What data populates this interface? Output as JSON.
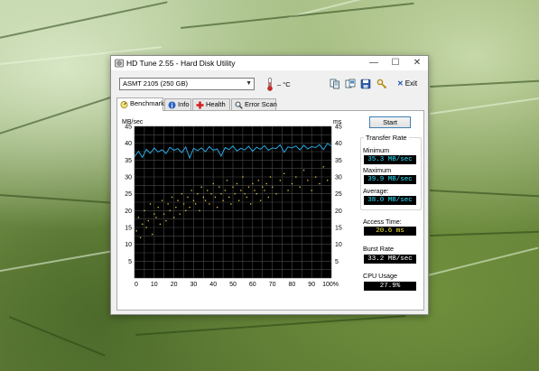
{
  "window": {
    "title": "HD Tune 2.55 - Hard Disk Utility",
    "controls": {
      "minimize": "—",
      "maximize": "☐",
      "close": "✕"
    }
  },
  "toolbar": {
    "drive": "ASMT    2105 (250 GB)",
    "temperature": "– °C",
    "exit_label": "Exit",
    "icons": [
      "copy-info-icon",
      "copy-screen-icon",
      "save-icon",
      "options-icon"
    ]
  },
  "tabs": [
    {
      "label": "Benchmark",
      "icon": "benchmark-icon",
      "active": true
    },
    {
      "label": "Info",
      "icon": "info-icon"
    },
    {
      "label": "Health",
      "icon": "health-icon"
    },
    {
      "label": "Error Scan",
      "icon": "search-icon"
    }
  ],
  "start_label": "Start",
  "stats": {
    "transfer_rate_title": "Transfer Rate",
    "minimum_label": "Minimum",
    "minimum": "35.3 MB/sec",
    "maximum_label": "Maximum",
    "maximum": "39.9 MB/sec",
    "average_label": "Average:",
    "average": "38.0 MB/sec",
    "access_time_label": "Access Time:",
    "access_time": "20.6 ms",
    "burst_rate_label": "Burst Rate",
    "burst_rate": "33.2 MB/sec",
    "cpu_usage_label": "CPU Usage",
    "cpu_usage": "27.9%"
  },
  "colors": {
    "transfer_line": "#2aa7e0",
    "access_dots": "#e8d24a",
    "stat_value": "#2ee6ff",
    "access_value": "#ffee33",
    "exit_x": "#1f53b4"
  },
  "chart_data": {
    "type": "line",
    "left_axis_unit": "MB/sec",
    "right_axis_unit": "ms",
    "x_tick_labels": [
      "0",
      "10",
      "20",
      "30",
      "40",
      "50",
      "60",
      "70",
      "80",
      "90",
      "100%"
    ],
    "y_left_ticks": [
      "45",
      "40",
      "35",
      "30",
      "25",
      "20",
      "15",
      "10",
      "5"
    ],
    "y_right_ticks": [
      "45",
      "40",
      "35",
      "30",
      "25",
      "20",
      "15",
      "10",
      "5"
    ],
    "xlim": [
      0,
      100
    ],
    "ylim": [
      0,
      45
    ],
    "grid": true,
    "series": [
      {
        "kind": "line",
        "unit": "MB/sec",
        "x": [
          0,
          2,
          4,
          6,
          8,
          10,
          12,
          14,
          16,
          18,
          20,
          22,
          24,
          26,
          28,
          30,
          32,
          34,
          36,
          38,
          40,
          42,
          44,
          46,
          48,
          50,
          52,
          54,
          56,
          58,
          60,
          62,
          64,
          66,
          68,
          70,
          72,
          74,
          76,
          78,
          80,
          82,
          84,
          86,
          88,
          90,
          92,
          94,
          96,
          98,
          100
        ],
        "y": [
          36.0,
          37.6,
          35.8,
          38.2,
          37.0,
          38.6,
          37.4,
          38.1,
          36.9,
          38.8,
          37.9,
          38.4,
          37.2,
          38.9,
          35.6,
          38.5,
          37.8,
          38.6,
          37.5,
          39.0,
          37.9,
          38.3,
          36.2,
          38.7,
          38.1,
          39.2,
          37.7,
          38.5,
          38.0,
          39.1,
          37.6,
          38.8,
          38.2,
          39.3,
          37.9,
          38.6,
          38.4,
          39.5,
          37.3,
          38.9,
          38.6,
          39.2,
          38.0,
          39.4,
          38.3,
          39.0,
          38.7,
          39.6,
          38.1,
          39.9,
          39.2
        ]
      },
      {
        "kind": "scatter",
        "unit": "ms",
        "x": [
          1,
          2,
          3,
          4,
          5,
          6,
          7,
          8,
          9,
          10,
          11,
          12,
          13,
          14,
          15,
          16,
          17,
          18,
          19,
          20,
          21,
          22,
          23,
          24,
          25,
          26,
          27,
          28,
          29,
          30,
          31,
          32,
          33,
          34,
          35,
          36,
          37,
          38,
          39,
          40,
          41,
          42,
          43,
          44,
          45,
          46,
          47,
          48,
          49,
          50,
          51,
          52,
          53,
          54,
          55,
          56,
          57,
          58,
          59,
          60,
          61,
          62,
          63,
          64,
          65,
          66,
          67,
          68,
          69,
          70,
          72,
          74,
          76,
          78,
          80,
          82,
          84,
          86,
          88,
          90,
          92,
          94,
          96,
          98
        ],
        "y": [
          14,
          18,
          12,
          16,
          20,
          15,
          17,
          22,
          13,
          19,
          18,
          21,
          16,
          23,
          19,
          17,
          22,
          20,
          24,
          18,
          21,
          23,
          19,
          25,
          22,
          20,
          24,
          21,
          26,
          23,
          22,
          25,
          20,
          27,
          24,
          23,
          26,
          22,
          25,
          28,
          24,
          21,
          27,
          25,
          23,
          26,
          29,
          24,
          22,
          27,
          25,
          28,
          23,
          26,
          30,
          25,
          24,
          27,
          22,
          28,
          26,
          25,
          29,
          23,
          27,
          26,
          28,
          24,
          30,
          27,
          25,
          29,
          31,
          26,
          28,
          30,
          27,
          32,
          29,
          26,
          30,
          28,
          33,
          29
        ]
      }
    ]
  }
}
